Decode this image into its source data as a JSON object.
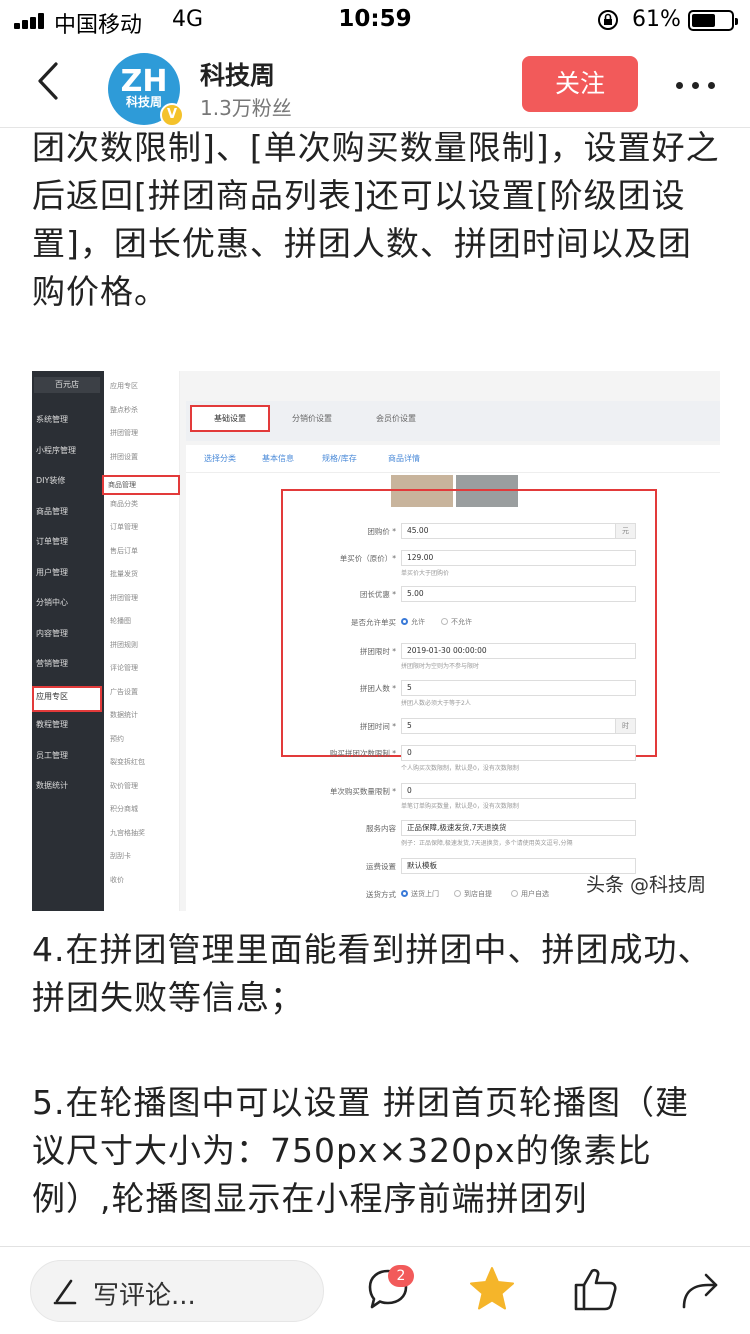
{
  "status_bar": {
    "carrier": "中国移动",
    "network": "4G",
    "time": "10:59",
    "battery_text": "61%",
    "battery_level": 0.61
  },
  "header": {
    "back_icon": "chevron-left-icon",
    "avatar": {
      "letters": "ZH",
      "caption": "科技周",
      "verify_mark": "V"
    },
    "author_name": "科技周",
    "fans": "1.3万粉丝",
    "follow_label": "关注",
    "more_icon": "more-dots-icon",
    "accent_color": "#f25a5a"
  },
  "article": {
    "paragraph_1": "团次数限制]、[单次购买数量限制]，设置好之后返回[拼团商品列表]还可以设置[阶级团设置]，团长优惠、拼团人数、拼团时间以及团购价格。",
    "paragraph_2": "4.在拼团管理里面能看到拼团中、拼团成功、拼团失败等信息；",
    "paragraph_3": "5.在轮播图中可以设置 拼团首页轮播图（建议尺寸大小为：750px×320px的像素比例）,轮播图显示在小程序前端拼团列"
  },
  "screenshot": {
    "store_name": "百元店",
    "side_menu": [
      "系统管理",
      "小程序管理",
      "DIY装修",
      "商品管理",
      "订单管理",
      "用户管理",
      "分销中心",
      "内容管理",
      "营销管理",
      "应用专区",
      "教程管理",
      "员工管理",
      "数据统计"
    ],
    "side_active": "应用专区",
    "sub_menu": [
      "应用专区",
      "整点秒杀",
      "拼团管理",
      "拼团设置",
      "商品管理",
      "商品分类",
      "订单管理",
      "售后订单",
      "批量发货",
      "拼团管理",
      "轮播图",
      "拼团规则",
      "评论管理",
      "广告设置",
      "数据统计",
      "预约",
      "裂变拆红包",
      "砍价管理",
      "积分商城",
      "九宫格抽奖",
      "刮刮卡",
      "收价"
    ],
    "sub_active": "商品管理",
    "tabs": [
      "基础设置",
      "分销价设置",
      "会员价设置"
    ],
    "subtabs": [
      "选择分类",
      "基本信息",
      "规格/库存",
      "商品详情"
    ],
    "form": {
      "group_price_label": "团购价 *",
      "group_price": "45.00",
      "group_price_unit": "元",
      "single_price_label": "单买价（原价）*",
      "single_price": "129.00",
      "single_price_hint": "单买价大于团购价",
      "leader_discount_label": "团长优惠 *",
      "leader_discount": "5.00",
      "allow_single_label": "是否允许单买",
      "allow_yes": "允许",
      "allow_no": "不允许",
      "time_limit_label": "拼团限时 *",
      "time_limit": "2019-01-30 00:00:00",
      "time_limit_hint": "拼团限时为空则为不参与限时",
      "group_size_label": "拼团人数 *",
      "group_size": "5",
      "group_size_hint": "拼团人数必须大于等于2人",
      "group_time_label": "拼团时间 *",
      "group_time": "5",
      "group_time_unit": "时",
      "buy_times_label": "购买拼团次数限制 *",
      "buy_times": "0",
      "buy_times_hint": "个人购买次数限制，默认是0，没有次数限制",
      "single_qty_label": "单次购买数量限制 *",
      "single_qty": "0",
      "single_qty_hint": "单笔订单购买数量，默认是0，没有次数限制",
      "service_label": "服务内容",
      "service": "正品保障,极速发货,7天退换货",
      "service_hint": "例子：正品保障,极速发货,7天退换货，多个请使用英文逗号,分隔",
      "shipping_label": "运费设置",
      "shipping": "默认模板",
      "delivery_label": "送货方式",
      "delivery_options": [
        "送货上门",
        "到店自提",
        "用户自选"
      ]
    },
    "watermark": "头条 @科技周"
  },
  "bottom_bar": {
    "comment_placeholder": "写评论...",
    "comment_count": "2",
    "icons": [
      "pen-icon",
      "comment-icon",
      "star-icon",
      "like-icon",
      "share-icon"
    ],
    "star_color": "#f5b52a"
  }
}
